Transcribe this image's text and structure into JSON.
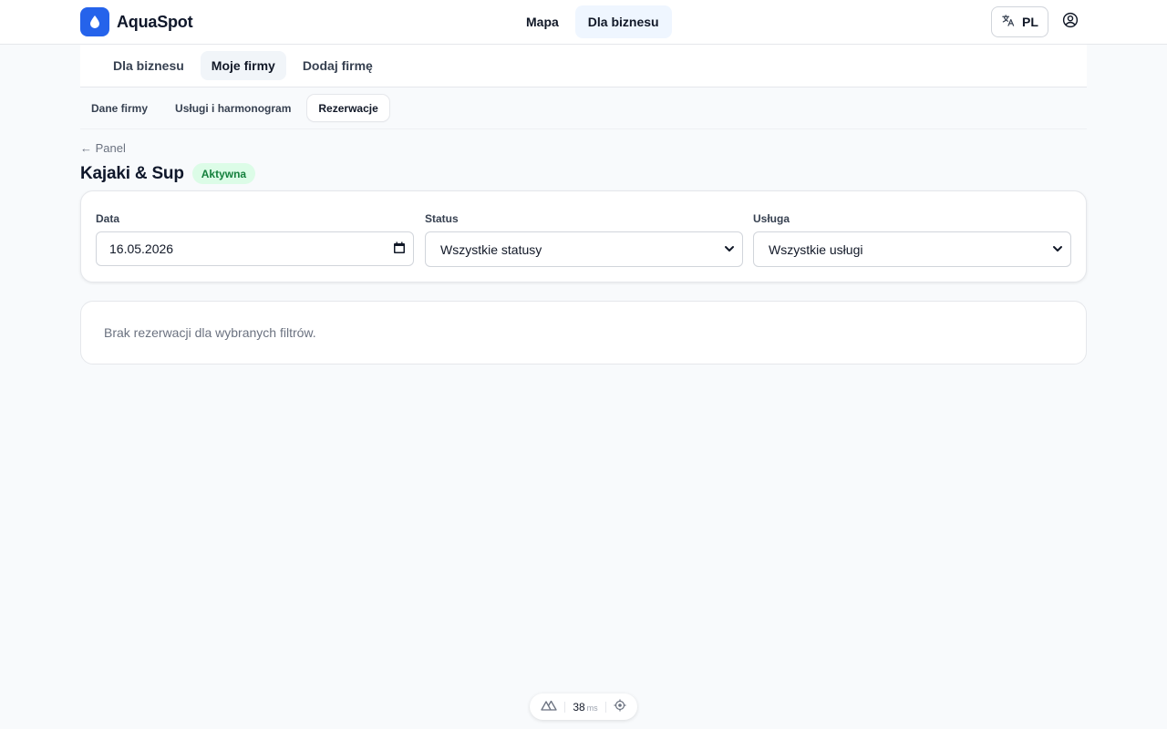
{
  "header": {
    "app_name": "AquaSpot",
    "nav": [
      {
        "label": "Mapa",
        "active": false
      },
      {
        "label": "Dla biznesu",
        "active": true
      }
    ],
    "language": "PL",
    "icons": {
      "logo": "droplet-icon",
      "language": "translate-icon",
      "user": "user-circle-icon"
    }
  },
  "subnav": {
    "items": [
      {
        "label": "Dla biznesu",
        "active": false
      },
      {
        "label": "Moje firmy",
        "active": true
      },
      {
        "label": "Dodaj firmę",
        "active": false
      }
    ]
  },
  "tabs": {
    "items": [
      {
        "label": "Dane firmy",
        "active": false
      },
      {
        "label": "Usługi i harmonogram",
        "active": false
      },
      {
        "label": "Rezerwacje",
        "active": true
      }
    ]
  },
  "page": {
    "back_label": "← Panel",
    "title": "Kajaki & Sup",
    "status": "Aktywna"
  },
  "filters": {
    "date": {
      "label": "Data",
      "value": "16.05.2026"
    },
    "status": {
      "label": "Status",
      "value": "Wszystkie statusy"
    },
    "service": {
      "label": "Usługa",
      "value": "Wszystkie usługi"
    }
  },
  "results": {
    "empty_message": "Brak rezerwacji dla wybranych filtrów."
  },
  "devtools": {
    "render_time": "38",
    "unit": "ms"
  },
  "colors": {
    "accent": "#2563eb",
    "active_nav_bg": "#eff6ff",
    "badge_bg": "#dcfce7",
    "badge_text": "#15803d",
    "page_bg": "#f8fafc"
  }
}
